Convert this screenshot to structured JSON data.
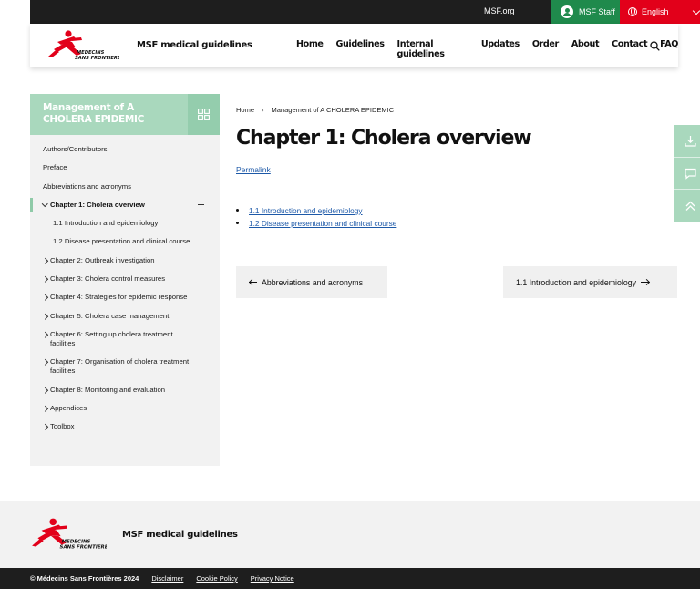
{
  "topbar": {
    "msf_org": "MSF.org",
    "staff": "MSF Staff",
    "language": "English"
  },
  "header": {
    "site_title": "MSF medical guidelines",
    "nav": [
      "Home",
      "Guidelines",
      "Internal guidelines",
      "Updates",
      "Order",
      "About",
      "Contact",
      "FAQ"
    ]
  },
  "sidebar": {
    "title": "Management of A CHOLERA EPIDEMIC",
    "items": [
      {
        "label": "Authors/Contributors"
      },
      {
        "label": "Preface"
      },
      {
        "label": "Abbreviations and acronyms"
      },
      {
        "label": "Chapter 1: Cholera overview"
      },
      {
        "label": "1.1 Introduction and epidemiology"
      },
      {
        "label": "1.2 Disease presentation and clinical course"
      },
      {
        "label": "Chapter 2: Outbreak investigation"
      },
      {
        "label": "Chapter 3: Cholera control measures"
      },
      {
        "label": "Chapter 4: Strategies for epidemic response"
      },
      {
        "label": "Chapter 5: Cholera case management"
      },
      {
        "label": "Chapter 6: Setting up cholera treatment facilities"
      },
      {
        "label": "Chapter 7: Organisation of cholera treatment facilities"
      },
      {
        "label": "Chapter 8: Monitoring and evaluation"
      },
      {
        "label": "Appendices"
      },
      {
        "label": "Toolbox"
      }
    ]
  },
  "breadcrumb": {
    "home": "Home",
    "current": "Management of A CHOLERA EPIDEMIC"
  },
  "main": {
    "title": "Chapter 1: Cholera overview",
    "permalink": "Permalink",
    "toc": [
      "1.1 Introduction and epidemiology",
      "1.2 Disease presentation and clinical course"
    ],
    "prev_label": "Abbreviations and acronyms",
    "next_label": "1.1 Introduction and epidemiology"
  },
  "footer": {
    "site_title": "MSF medical guidelines",
    "copyright": "© Médecins Sans Frontières 2024",
    "links": [
      "Disclaimer",
      "Cookie Policy",
      "Privacy Notice"
    ]
  },
  "colors": {
    "brand_red": "#e2001a",
    "staff_green": "#1f8a4c",
    "accent_mint": "#a9d8bd",
    "link_blue": "#1d59a8"
  },
  "icons": {
    "logo": "msf-running-man-logo",
    "search": "search-icon",
    "grid": "grid-icon",
    "download": "download-icon",
    "comment": "comment-icon",
    "top": "scroll-top-icon"
  }
}
